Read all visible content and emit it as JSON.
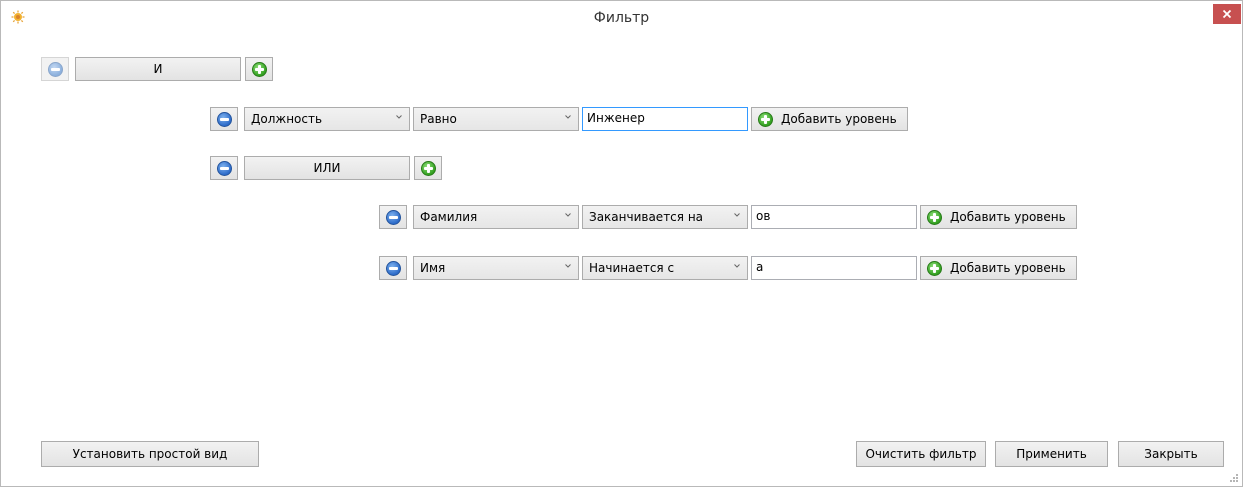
{
  "window": {
    "title": "Фильтр",
    "close_icon": "close-icon",
    "app_icon": "app-icon"
  },
  "groups": {
    "root": {
      "operator": "И"
    },
    "nested": {
      "operator": "ИЛИ"
    }
  },
  "conditions": [
    {
      "field": "Должность",
      "operator": "Равно",
      "value": "Инженер",
      "add_label": "Добавить уровень"
    },
    {
      "field": "Фамилия",
      "operator": "Заканчивается на",
      "value": "ов",
      "add_label": "Добавить уровень"
    },
    {
      "field": "Имя",
      "operator": "Начинается с",
      "value": "а",
      "add_label": "Добавить уровень"
    }
  ],
  "footer": {
    "simple_view": "Установить простой вид",
    "clear": "Очистить фильтр",
    "apply": "Применить",
    "close": "Закрыть"
  },
  "colors": {
    "close_button": "#c75050",
    "remove_icon": "#2c6bc9",
    "add_icon": "#33a020",
    "focus_border": "#3399ff"
  }
}
